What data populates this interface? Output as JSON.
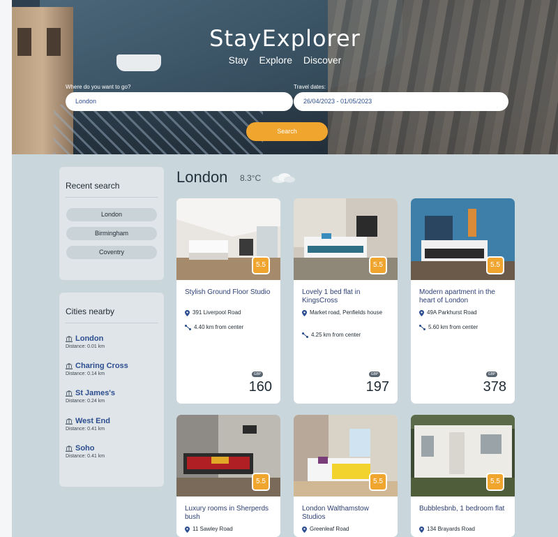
{
  "hero": {
    "brand": "StayExplorer",
    "tagline": [
      "Stay",
      "Explore",
      "Discover"
    ],
    "destination_label": "Where do you want to go?",
    "destination_value": "London",
    "dates_label": "Travel dates:",
    "dates_value": "26/04/2023 - 01/05/2023",
    "search_label": "Search"
  },
  "recent": {
    "title": "Recent search",
    "items": [
      "London",
      "Birmingham",
      "Coventry"
    ]
  },
  "nearby": {
    "title": "Cities nearby",
    "items": [
      {
        "name": "London",
        "distance": "Distance: 0.01 km"
      },
      {
        "name": "Charing Cross",
        "distance": "Distance: 0.14 km"
      },
      {
        "name": "St James's",
        "distance": "Distance: 0.24 km"
      },
      {
        "name": "West End",
        "distance": "Distance: 0.41 km"
      },
      {
        "name": "Soho",
        "distance": "Distance: 0.41 km"
      }
    ]
  },
  "location": {
    "city": "London",
    "temperature": "8.3°C",
    "weather_icon": "cloud-icon"
  },
  "listings": [
    {
      "title": "Stylish Ground Floor Studio",
      "address": "391 Liverpool Road",
      "distance": "4.40 km from center",
      "rating": "5.5",
      "currency": "GBP",
      "price": "160"
    },
    {
      "title": "Lovely 1 bed flat in KingsCross",
      "address": "Market road, Penfields house",
      "distance": "4.25 km from center",
      "rating": "5.5",
      "currency": "GBP",
      "price": "197"
    },
    {
      "title": "Modern apartment in the heart of London",
      "address": "49A Parkhurst Road",
      "distance": "5.60 km from center",
      "rating": "5.5",
      "currency": "GBP",
      "price": "378"
    },
    {
      "title": "Luxury rooms in Sherperds bush",
      "address": "11 Sawley Road",
      "rating": "5.5"
    },
    {
      "title": "London Walthamstow Studios",
      "address": "Greenleaf Road",
      "rating": "5.5"
    },
    {
      "title": "Bubblesbnb, 1 bedroom flat",
      "address": "134 Brayards Road",
      "rating": "5.5"
    }
  ],
  "colors": {
    "accent": "#f0a52e",
    "link": "#2c4d8f",
    "page_bg": "#c9d7dc"
  }
}
